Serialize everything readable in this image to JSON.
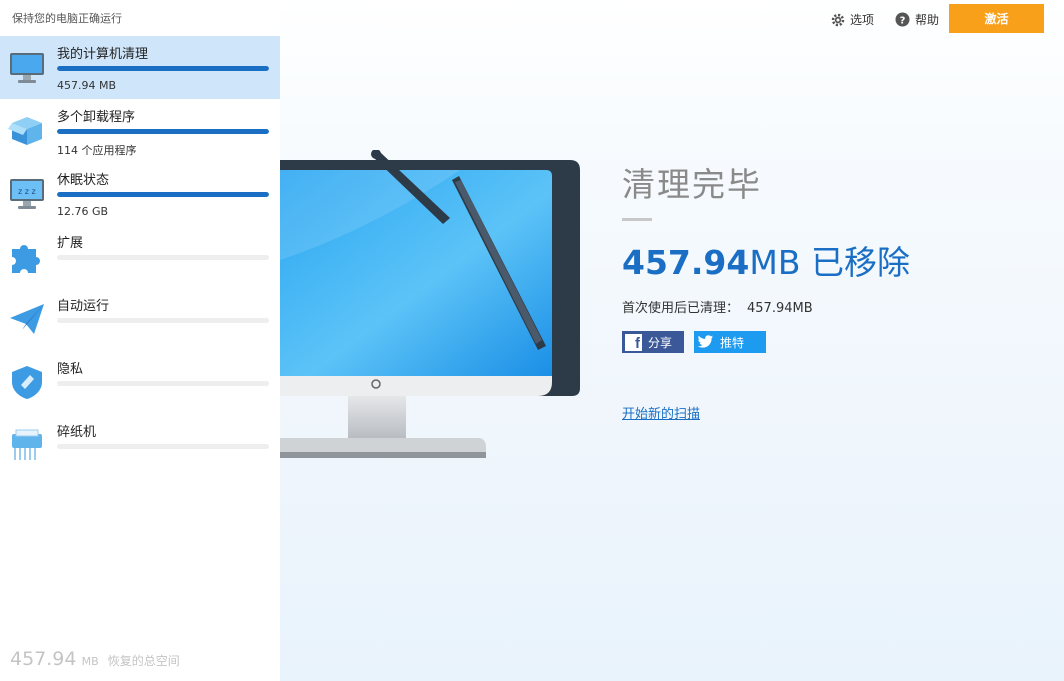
{
  "app": {
    "subtitle": "保持您的电脑正确运行"
  },
  "topbar": {
    "options_label": "选项",
    "help_label": "帮助",
    "activate_label": "激活"
  },
  "sidebar": {
    "items": [
      {
        "label": "我的计算机清理",
        "meta": "457.94 MB",
        "progress": 1.0,
        "active": true,
        "icon": "monitor-icon"
      },
      {
        "label": "多个卸载程序",
        "meta": "114 个应用程序",
        "progress": 1.0,
        "active": false,
        "icon": "box-icon"
      },
      {
        "label": "休眠状态",
        "meta": "12.76 GB",
        "progress": 1.0,
        "active": false,
        "icon": "sleep-monitor-icon"
      },
      {
        "label": "扩展",
        "meta": "",
        "progress": 0.0,
        "active": false,
        "icon": "puzzle-icon"
      },
      {
        "label": "自动运行",
        "meta": "",
        "progress": 0.0,
        "active": false,
        "icon": "paper-plane-icon"
      },
      {
        "label": "隐私",
        "meta": "",
        "progress": 0.0,
        "active": false,
        "icon": "shield-icon"
      },
      {
        "label": "碎纸机",
        "meta": "",
        "progress": 0.0,
        "active": false,
        "icon": "shredder-icon"
      }
    ],
    "total": {
      "number": "457.94",
      "unit": "MB",
      "text": "恢复的总空间"
    }
  },
  "result": {
    "title": "清理完毕",
    "removed_number": "457.94",
    "removed_unit_text": "MB 已移除",
    "since_label": "首次使用后已清理：",
    "since_value": "457.94MB",
    "share_facebook": "分享",
    "share_twitter": "推特",
    "rescan_link": "开始新的扫描"
  },
  "colors": {
    "accent": "#1a6fc4",
    "activate": "#f9a01b",
    "active_item_bg": "#cfe6fa",
    "facebook": "#3b5998",
    "twitter": "#1d9bf0"
  }
}
